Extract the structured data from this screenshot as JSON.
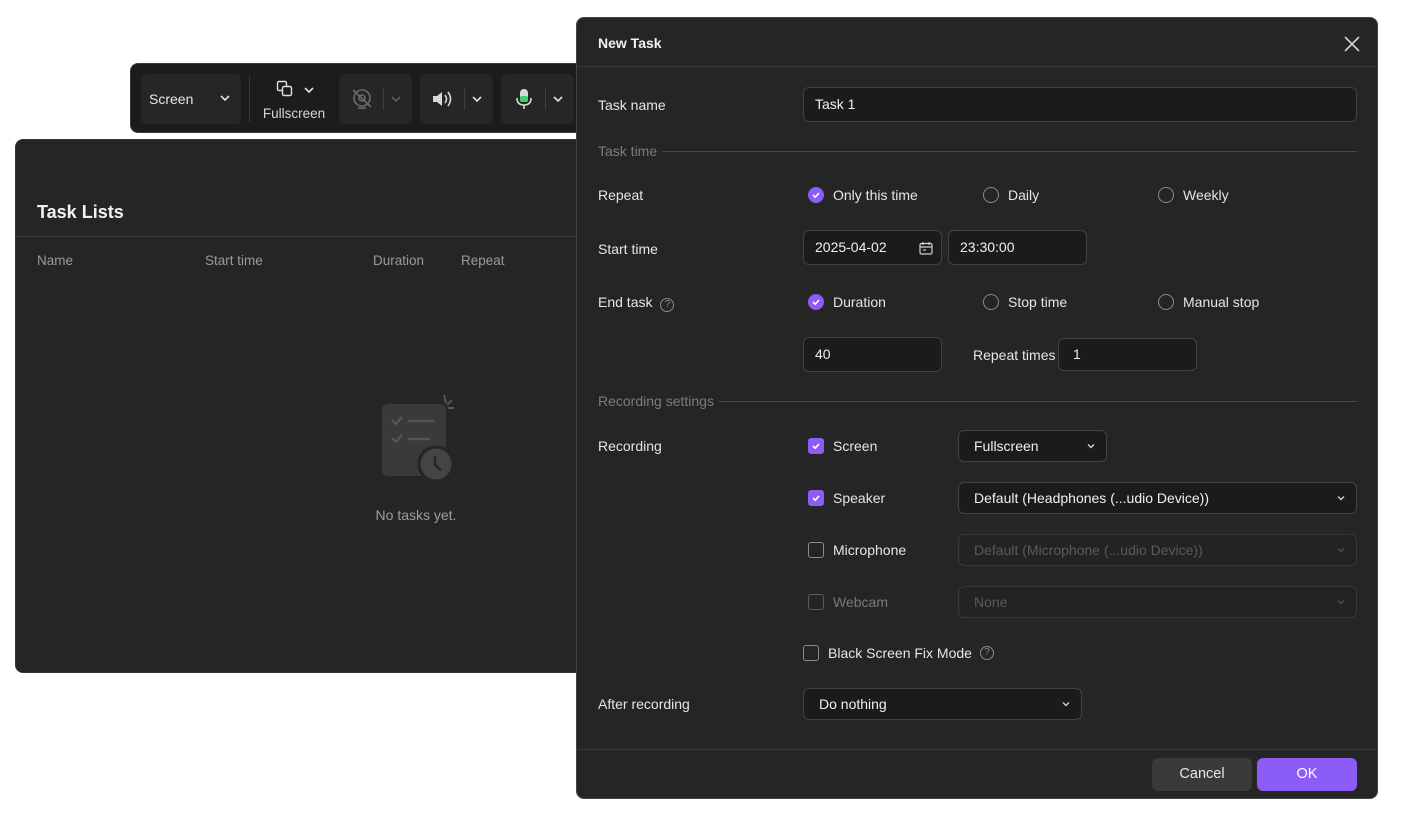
{
  "toolbar": {
    "source_label": "Screen",
    "mode_label": "Fullscreen",
    "icons": [
      "fullscreen-icon",
      "webcam-off-icon",
      "speaker-icon",
      "microphone-icon"
    ]
  },
  "task_list": {
    "title": "Task Lists",
    "columns": [
      "Name",
      "Start time",
      "Duration",
      "Repeat"
    ],
    "empty_text": "No tasks yet."
  },
  "dialog": {
    "title": "New Task",
    "task_name_label": "Task name",
    "task_name_value": "Task 1",
    "section_task_time": "Task time",
    "repeat_label": "Repeat",
    "repeat_options": [
      "Only this time",
      "Daily",
      "Weekly"
    ],
    "repeat_selected": "Only this time",
    "start_time_label": "Start time",
    "start_date": "2025-04-02",
    "start_clock": "23:30:00",
    "end_task_label": "End task",
    "end_options": [
      "Duration",
      "Stop time",
      "Manual stop"
    ],
    "end_selected": "Duration",
    "duration_value": "40",
    "repeat_times_label": "Repeat times",
    "repeat_times_value": "1",
    "section_recording": "Recording settings",
    "recording_label": "Recording",
    "screen_label": "Screen",
    "screen_mode": "Fullscreen",
    "speaker_label": "Speaker",
    "speaker_device": "Default (Headphones (...udio Device))",
    "microphone_label": "Microphone",
    "microphone_device": "Default (Microphone (...udio Device))",
    "webcam_label": "Webcam",
    "webcam_device": "None",
    "black_screen_label": "Black Screen Fix Mode",
    "after_recording_label": "After recording",
    "after_recording_value": "Do nothing",
    "cancel_label": "Cancel",
    "ok_label": "OK"
  },
  "colors": {
    "accent": "#8b5cf6",
    "background": "#252525",
    "input_bg": "#1b1b1b"
  }
}
